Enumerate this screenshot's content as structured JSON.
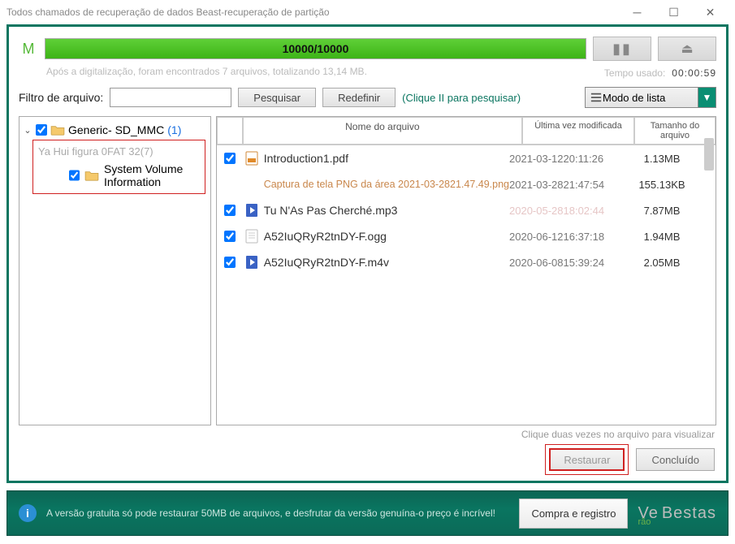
{
  "window": {
    "title": "Todos chamados de recuperação de dados Beast-recuperação de partição"
  },
  "progress": {
    "label": "M",
    "text": "10000/10000"
  },
  "scan_summary": "Após a digitalização, foram encontrados 7 arquivos, totalizando 13,14 MB.",
  "time": {
    "label": "Tempo usado:",
    "value": "00:00:59"
  },
  "filter": {
    "label": "Filtro de arquivo:",
    "value": "",
    "search_btn": "Pesquisar",
    "reset_btn": "Redefinir",
    "tip": "(Clique II para pesquisar)"
  },
  "mode": {
    "selected": "Modo de lista",
    "icon": "list-icon"
  },
  "tree": {
    "root": {
      "label": "Generic- SD_MMC",
      "count": "(1)"
    },
    "sub1": "Ya Hui figura 0FAT 32(7)",
    "sub2": "System Volume Information"
  },
  "columns": {
    "name": "Nome do arquivo",
    "modified": "Última vez modificada",
    "size": "Tamanho do arquivo"
  },
  "files": [
    {
      "name": "Introduction1.pdf",
      "modified": "2021-03-1220:11:26",
      "size": "1.13MB",
      "kind": "pdf",
      "checked": true
    },
    {
      "name": "Captura de tela PNG da área 2021-03-2821.47.49.png",
      "modified": "2021-03-2821:47:54",
      "size": "155.13KB",
      "kind": "png",
      "checked": false,
      "orange": true
    },
    {
      "name": "Tu N'As Pas Cherché.mp3",
      "modified": "2020-05-2818:02:44",
      "size": "7.87MB",
      "kind": "audio",
      "checked": true,
      "faded": true
    },
    {
      "name": "A52IuQRyR2tnDY-F.ogg",
      "modified": "2020-06-1216:37:18",
      "size": "1.94MB",
      "kind": "file",
      "checked": true
    },
    {
      "name": "A52IuQRyR2tnDY-F.m4v",
      "modified": "2020-06-0815:39:24",
      "size": "2.05MB",
      "kind": "video",
      "checked": true
    }
  ],
  "hint": "Clique duas vezes no arquivo para visualizar",
  "actions": {
    "restore": "Restaurar",
    "done": "Concluído"
  },
  "footer": {
    "text": "A versão gratuita só pode restaurar 50MB de arquivos, e desfrutar da versão genuína-o preço é incrível!",
    "buy_btn": "Compra e registro",
    "logo1": "Ve",
    "logo2": "Bestas",
    "logo3": "rão"
  }
}
